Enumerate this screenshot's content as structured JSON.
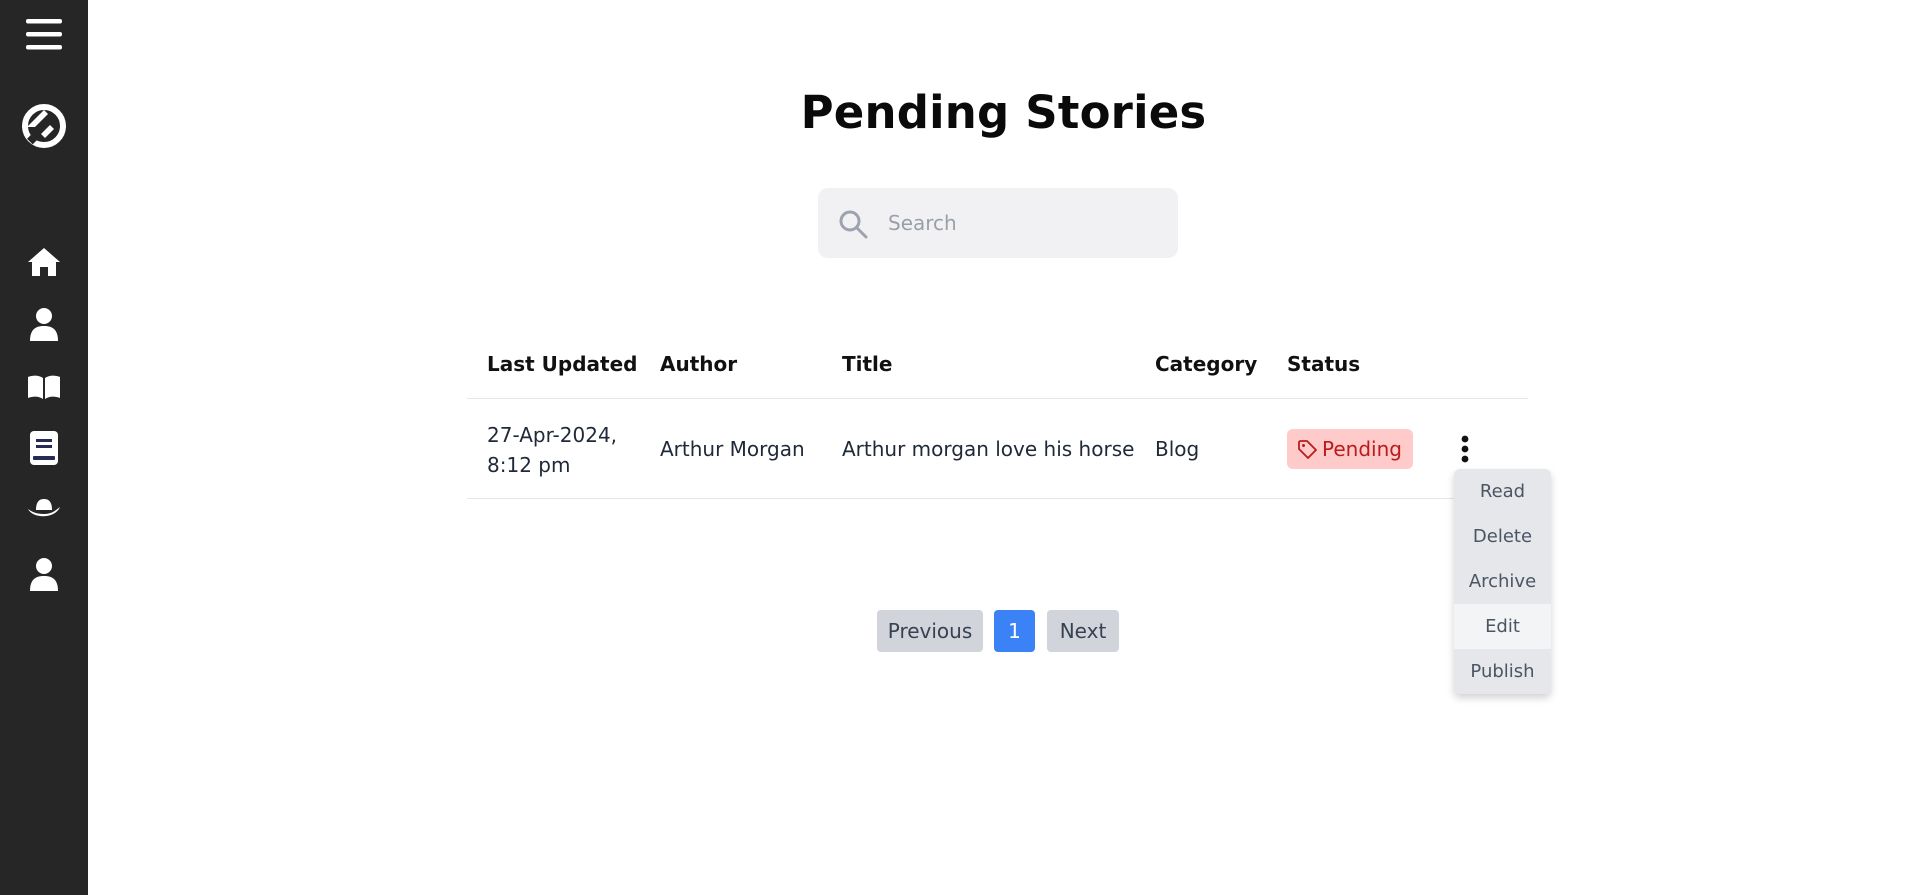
{
  "sidebar": {
    "icons": [
      "menu-icon",
      "logo-icon",
      "home-icon",
      "user-icon",
      "book-open-icon",
      "book-icon",
      "hat-icon",
      "profile-icon"
    ],
    "background": "#262626"
  },
  "page": {
    "title": "Pending Stories"
  },
  "search": {
    "placeholder": "Search",
    "value": ""
  },
  "table": {
    "columns": [
      "Last Updated",
      "Author",
      "Title",
      "Category",
      "Status"
    ],
    "rows": [
      {
        "last_updated_line1": "27-Apr-2024,",
        "last_updated_line2": "8:12 pm",
        "author": "Arthur Morgan",
        "title": "Arthur morgan love his horse",
        "category": "Blog",
        "status": "Pending"
      }
    ]
  },
  "actions_menu": {
    "items": [
      "Read",
      "Delete",
      "Archive",
      "Edit",
      "Publish"
    ],
    "highlighted": "Edit"
  },
  "pagination": {
    "previous": "Previous",
    "current": "1",
    "next": "Next"
  },
  "colors": {
    "accent": "#3b82f6",
    "badge_bg": "#fecaca",
    "badge_text": "#b91c1c"
  }
}
